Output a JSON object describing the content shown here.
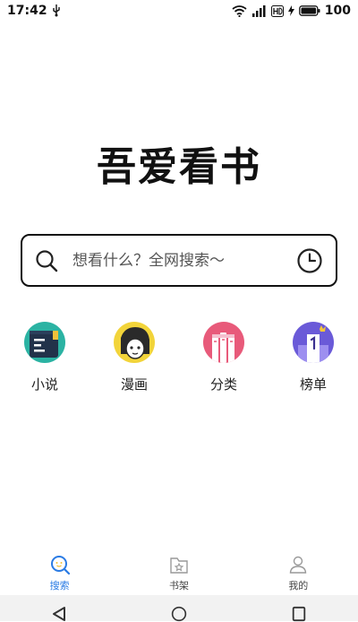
{
  "status_bar": {
    "time": "17:42",
    "battery": "100"
  },
  "logo": {
    "text": "吾爱看书"
  },
  "search": {
    "placeholder": "想看什么？全网搜索～"
  },
  "categories": [
    {
      "label": "小说",
      "color": "#2bb3a3"
    },
    {
      "label": "漫画",
      "color": "#f2d43a"
    },
    {
      "label": "分类",
      "color": "#e85a7a"
    },
    {
      "label": "榜单",
      "color": "#6a5ad8"
    }
  ],
  "bottom_nav": [
    {
      "label": "搜索",
      "active": true
    },
    {
      "label": "书架",
      "active": false
    },
    {
      "label": "我的",
      "active": false
    }
  ],
  "colors": {
    "accent": "#2a7be4"
  }
}
